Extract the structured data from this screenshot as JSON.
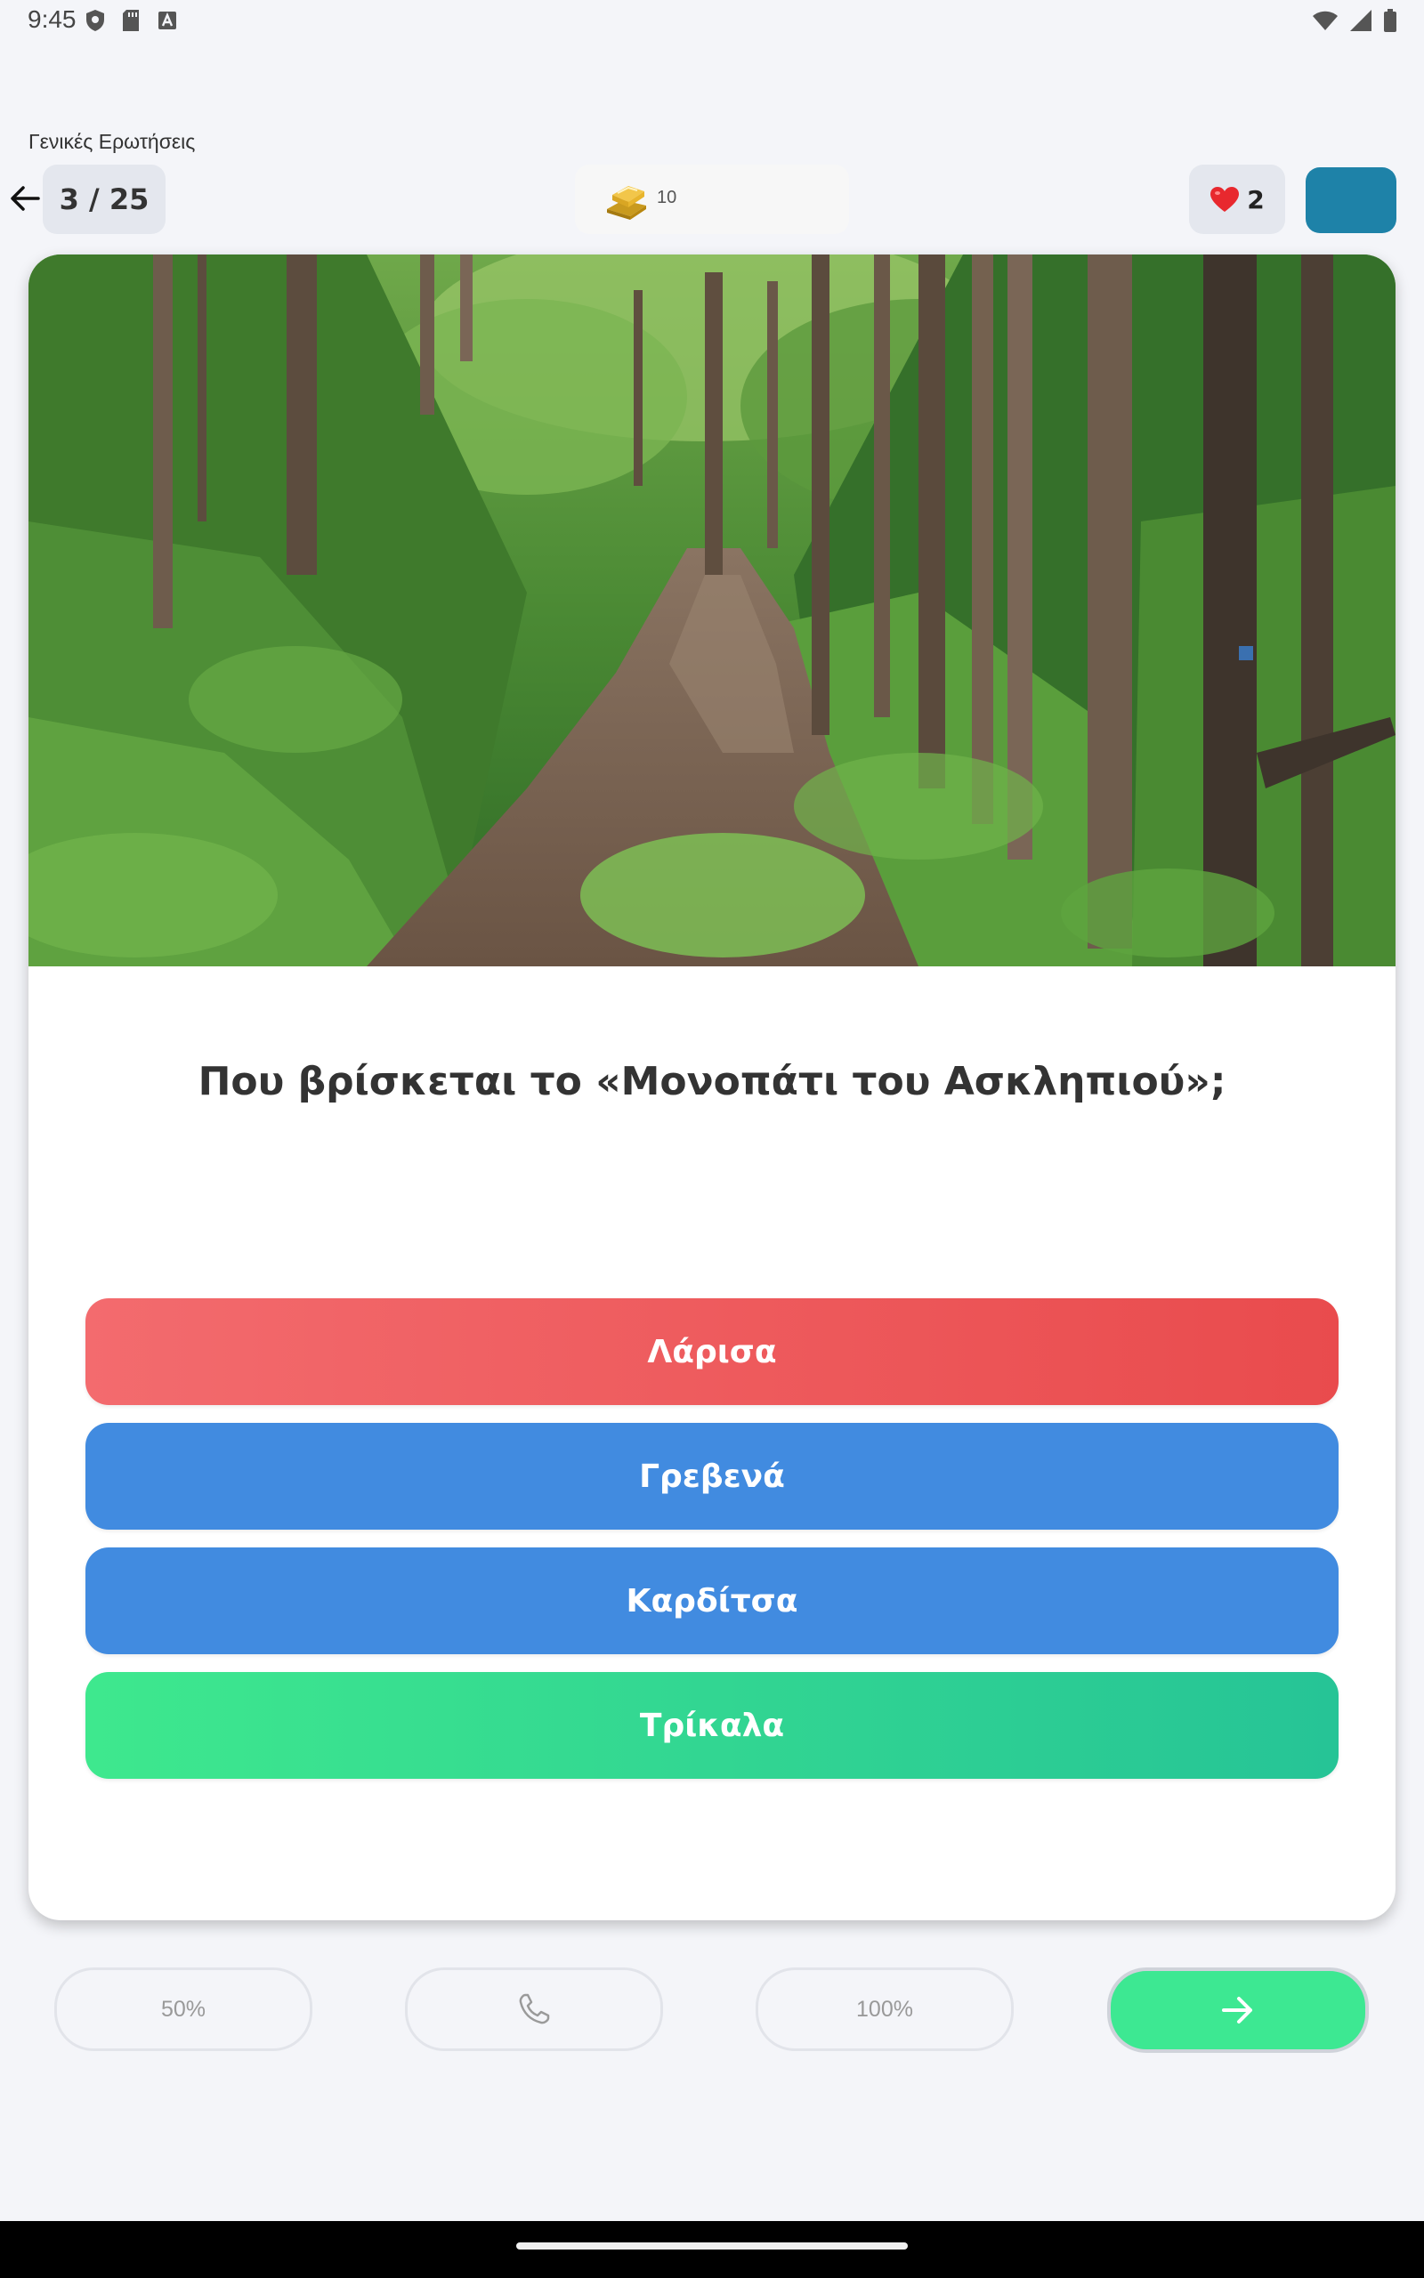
{
  "status_bar": {
    "time": "9:45"
  },
  "header": {
    "category": "Γενικές Ερωτήσεις",
    "progress": "3 / 25",
    "coins": "10",
    "lives": "2"
  },
  "question": {
    "text": "Που βρίσκεται το «Μονοπάτι του Ασκληπιού»;",
    "answers": [
      {
        "label": "Λάρισα",
        "state": "wrong"
      },
      {
        "label": "Γρεβενά",
        "state": "normal"
      },
      {
        "label": "Καρδίτσα",
        "state": "normal"
      },
      {
        "label": "Τρίκαλα",
        "state": "correct"
      }
    ]
  },
  "lifelines": {
    "fifty": "50%",
    "phone_icon": "phone-icon",
    "hundred": "100%",
    "next_icon": "arrow-right-icon"
  },
  "colors": {
    "wrong": "#e94b4d",
    "normal": "#418be0",
    "correct": "#2fd892",
    "profile": "#1e82a8"
  }
}
